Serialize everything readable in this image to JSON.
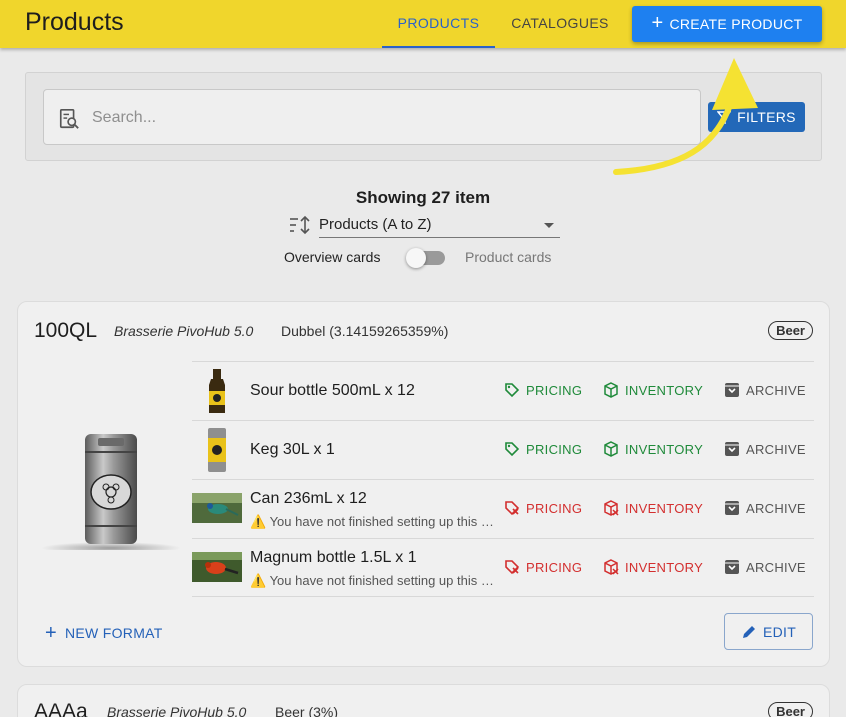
{
  "header": {
    "title": "Products",
    "tabs": [
      {
        "label": "PRODUCTS",
        "active": true
      },
      {
        "label": "CATALOGUES",
        "active": false
      }
    ],
    "create_button": "CREATE PRODUCT"
  },
  "search": {
    "placeholder": "Search...",
    "filters_label": "FILTERS"
  },
  "listing": {
    "showing": "Showing 27 item",
    "sort_value": "Products (A to Z)",
    "toggle_left": "Overview cards",
    "toggle_right": "Product cards"
  },
  "products": [
    {
      "code": "100QL",
      "brewery": "Brasserie PivoHub 5.0",
      "style": "Dubbel (3.14159265359%)",
      "badge": "Beer",
      "formats": [
        {
          "name": "Sour bottle 500mL x 12",
          "warning": "",
          "status": "ok"
        },
        {
          "name": "Keg 30L x 1",
          "warning": "",
          "status": "ok"
        },
        {
          "name": "Can 236mL x 12",
          "warning": "⚠️ You have not finished setting up this format",
          "status": "warn"
        },
        {
          "name": "Magnum bottle 1.5L x 1",
          "warning": "⚠️ You have not finished setting up this format",
          "status": "warn"
        }
      ],
      "actions": {
        "pricing": "PRICING",
        "inventory": "INVENTORY",
        "archive": "ARCHIVE"
      },
      "new_format": "NEW FORMAT",
      "edit": "EDIT"
    },
    {
      "code": "AAAa",
      "brewery": "Brasserie PivoHub 5.0",
      "style": "Beer (3%)",
      "badge": "Beer"
    }
  ],
  "icons": {
    "create": "plus-icon",
    "search": "search-document-icon",
    "filters": "filter-icon",
    "sort": "sort-icon",
    "pricing": "tag-icon",
    "inventory": "box-icon",
    "archive": "archive-icon",
    "new_format": "plus-icon",
    "edit": "pencil-icon"
  },
  "colors": {
    "topbar": "#f0d62c",
    "primary": "#1e80f0",
    "tab_active": "#2a62c9",
    "ok": "#1f8a3a",
    "warn": "#d32f2f",
    "annotation_arrow": "#f5e232"
  }
}
